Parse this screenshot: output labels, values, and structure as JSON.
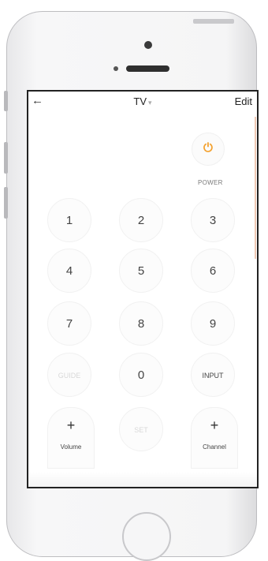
{
  "nav": {
    "back_icon": "arrow-left-icon",
    "title": "TV",
    "title_caret": "▾",
    "edit_label": "Edit"
  },
  "power": {
    "icon": "power-icon",
    "glyph": "⏻",
    "label": "POWER",
    "color": "#f4a12e"
  },
  "keypad": {
    "keys": [
      "1",
      "2",
      "3",
      "4",
      "5",
      "6",
      "7",
      "8",
      "9"
    ],
    "guide": "GUIDE",
    "zero": "0",
    "input": "INPUT",
    "set": "SET"
  },
  "volume": {
    "plus": "+",
    "label": "Volume"
  },
  "channel": {
    "plus": "+",
    "label": "Channel"
  }
}
